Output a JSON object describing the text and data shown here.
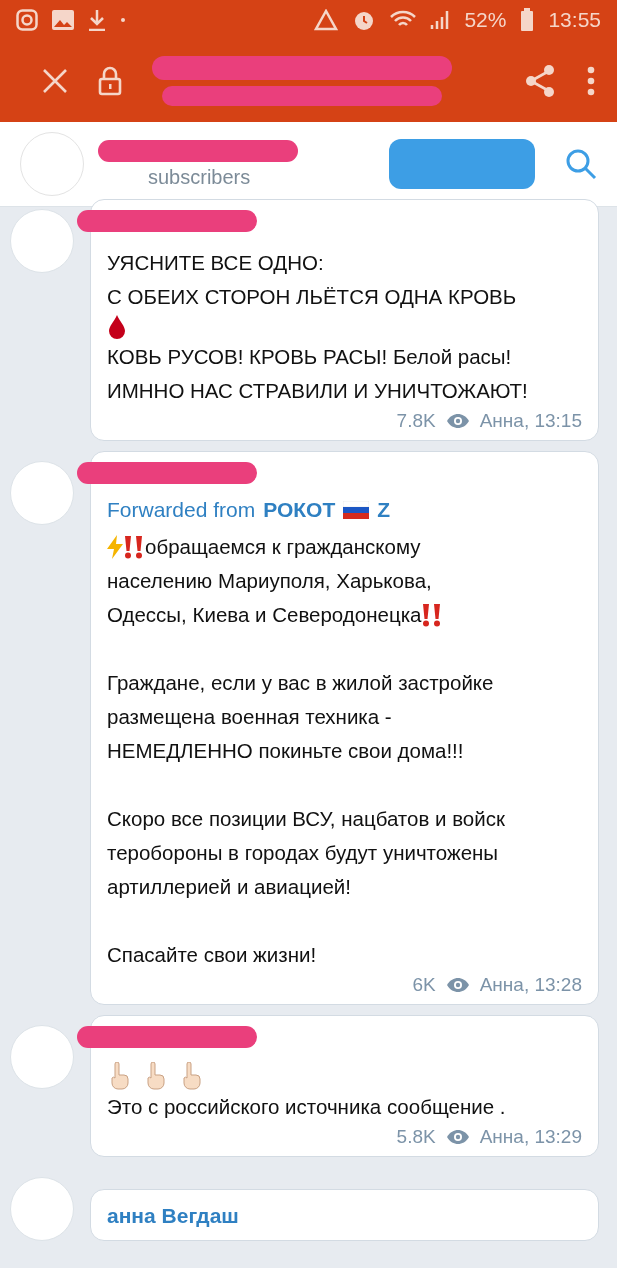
{
  "status_bar": {
    "battery": "52%",
    "time": "13:55"
  },
  "channel_header": {
    "subscribers": "subscribers"
  },
  "messages": [
    {
      "paragraphs": [
        [
          [
            {
              "kind": "text",
              "text": "УЯСНИТЕ ВСЕ ОДНО:"
            }
          ],
          [
            {
              "kind": "text",
              "text": "С ОБЕИХ СТОРОН ЛЬЁТСЯ ОДНА КРОВЬ"
            }
          ],
          [
            {
              "kind": "drop"
            }
          ],
          [
            {
              "kind": "text",
              "text": "КОВЬ РУСОВ! КРОВЬ РАСЫ! Белой расы!"
            }
          ],
          [
            {
              "kind": "text",
              "text": "ИМННО НАС СТРАВИЛИ И УНИЧТОЖАЮТ!"
            }
          ]
        ]
      ],
      "views": "7.8K",
      "signature": "Анна, 13:15"
    },
    {
      "forwarded": {
        "prefix": "Forwarded from",
        "name": "РОКОТ",
        "suffix": "Z"
      },
      "paragraphs": [
        [
          [
            {
              "kind": "lightning"
            },
            {
              "kind": "alert"
            },
            {
              "kind": "text",
              "text": "обращаемся к гражданскому"
            }
          ],
          [
            {
              "kind": "text",
              "text": "населению Мариуполя, Харькова,"
            }
          ],
          [
            {
              "kind": "text",
              "text": "Одессы, Киева и Северодонецка"
            },
            {
              "kind": "alert"
            }
          ]
        ],
        [
          [
            {
              "kind": "text",
              "text": "Граждане, если у вас в жилой застройке"
            }
          ],
          [
            {
              "kind": "text",
              "text": "размещена военная техника -"
            }
          ],
          [
            {
              "kind": "text",
              "text": "НЕМЕДЛЕННО покиньте свои дома!!!"
            }
          ]
        ],
        [
          [
            {
              "kind": "text",
              "text": "Скоро все позиции ВСУ, нацбатов и войск"
            }
          ],
          [
            {
              "kind": "text",
              "text": "теробороны в городах будут уничтожены"
            }
          ],
          [
            {
              "kind": "text",
              "text": "артиллерией и авиацией!"
            }
          ]
        ],
        [
          [
            {
              "kind": "text",
              "text": "Спасайте свои жизни!"
            }
          ]
        ]
      ],
      "views": "6K",
      "signature": "Анна, 13:28"
    },
    {
      "paragraphs": [
        [
          [
            {
              "kind": "pointing-up"
            },
            {
              "kind": "pointing-up"
            },
            {
              "kind": "pointing-up"
            }
          ],
          [
            {
              "kind": "text",
              "text": "Это с российского источника сообщение ."
            }
          ]
        ]
      ],
      "views": "5.8K",
      "signature": "Анна, 13:29"
    },
    {
      "author": "анна Вегдаш"
    }
  ]
}
